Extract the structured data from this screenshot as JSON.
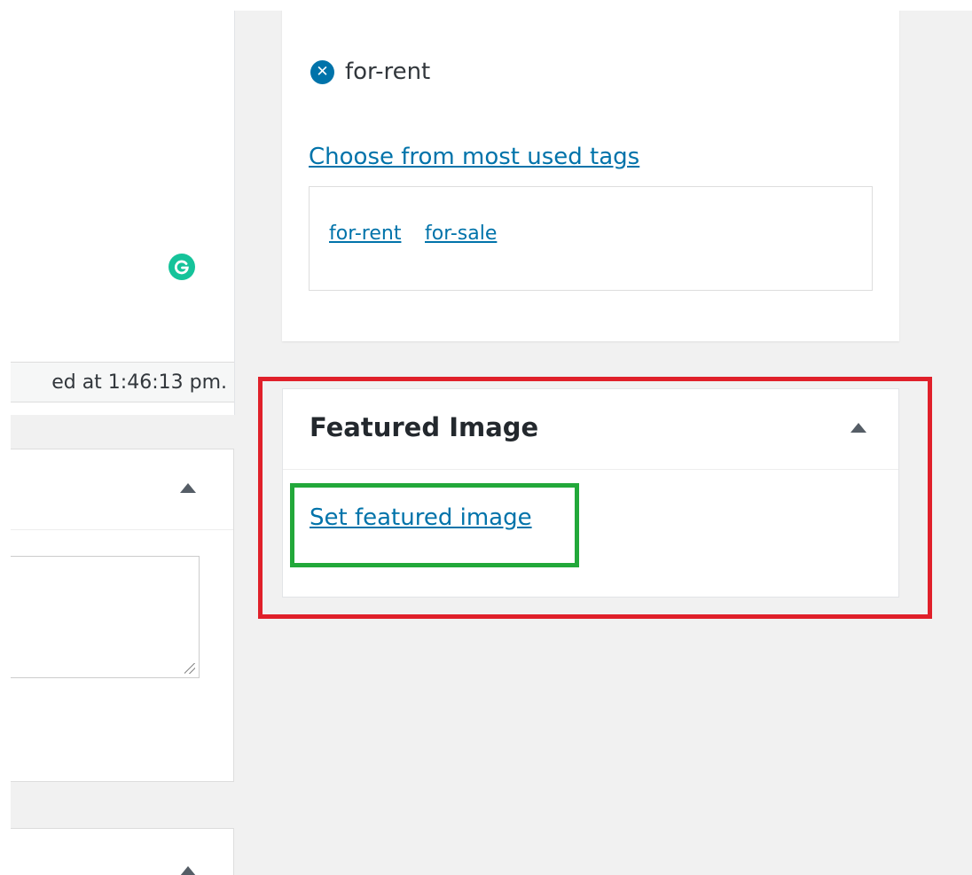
{
  "left_column": {
    "status_text": "ed at 1:46:13 pm.",
    "grammarly_label": "G"
  },
  "tags_panel": {
    "selected_tag": "for-rent",
    "remove_icon_glyph": "✕",
    "most_used_link": "Choose from most used tags",
    "cloud_tags": [
      "for-rent",
      "for-sale"
    ]
  },
  "featured_image": {
    "title": "Featured Image",
    "set_link": "Set featured image"
  },
  "colors": {
    "link": "#0073aa",
    "highlight_red": "#e0202a",
    "highlight_green": "#22a83a",
    "grammarly": "#15c39a"
  }
}
